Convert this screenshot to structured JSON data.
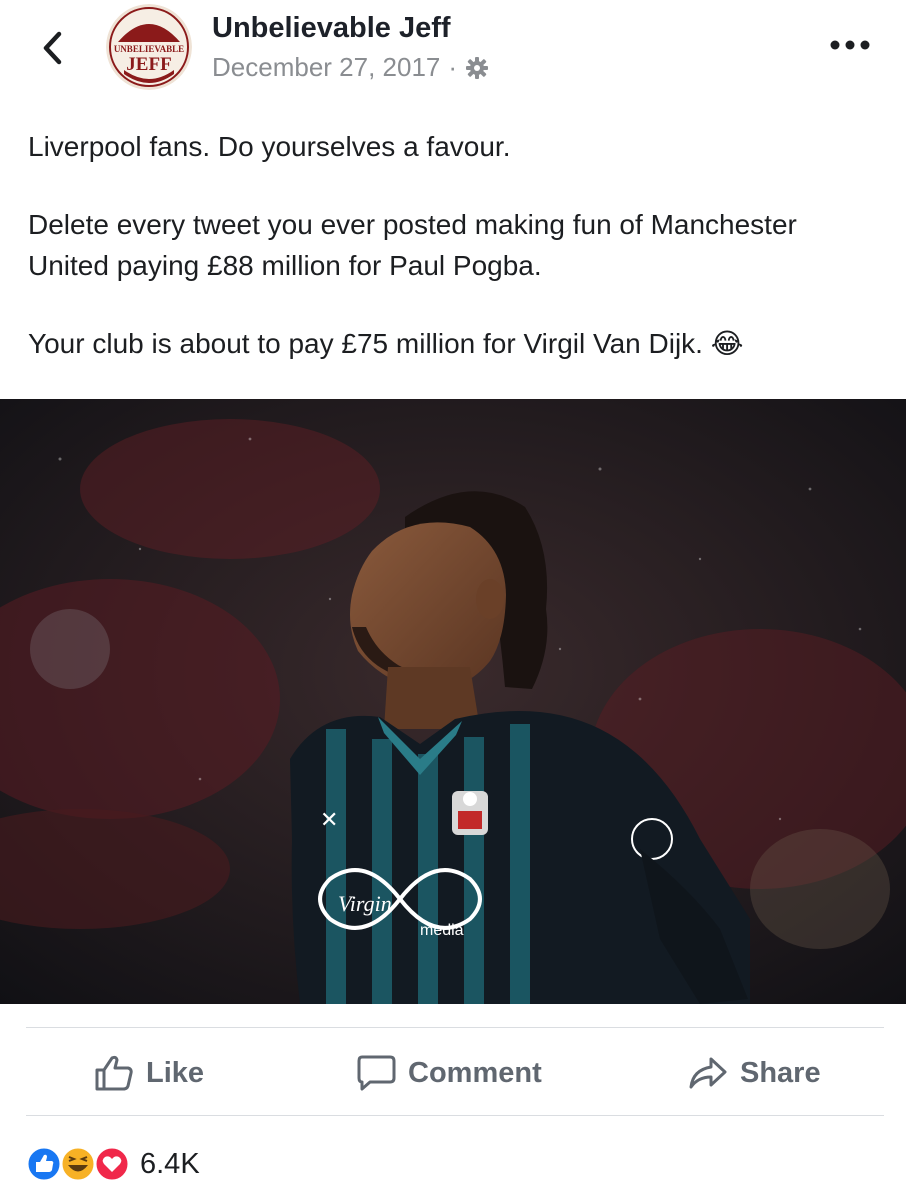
{
  "header": {
    "page_name": "Unbelievable Jeff",
    "date": "December 27, 2017",
    "separator": "·",
    "avatar_text_top": "UNBELIEVABLE",
    "avatar_text_bottom": "JEFF"
  },
  "post": {
    "line1": "Liverpool fans. Do yourselves a favour.",
    "line2": "Delete every tweet you ever posted making fun of Manchester United paying £88 million for Paul Pogba.",
    "line3": "Your club is about to pay £75 million for Virgil Van Dijk.",
    "emoji": "😂"
  },
  "photo": {
    "sponsor": "Virgin",
    "sponsor_sub": "media"
  },
  "actions": {
    "like": "Like",
    "comment": "Comment",
    "share": "Share"
  },
  "reactions": {
    "count": "6.4K",
    "types": [
      "like",
      "haha",
      "love"
    ]
  },
  "colors": {
    "like_blue": "#1877f2",
    "love_red": "#f0284a",
    "haha_yellow": "#f7b125",
    "muted": "#606770",
    "avatar_red": "#8b1a1a"
  }
}
